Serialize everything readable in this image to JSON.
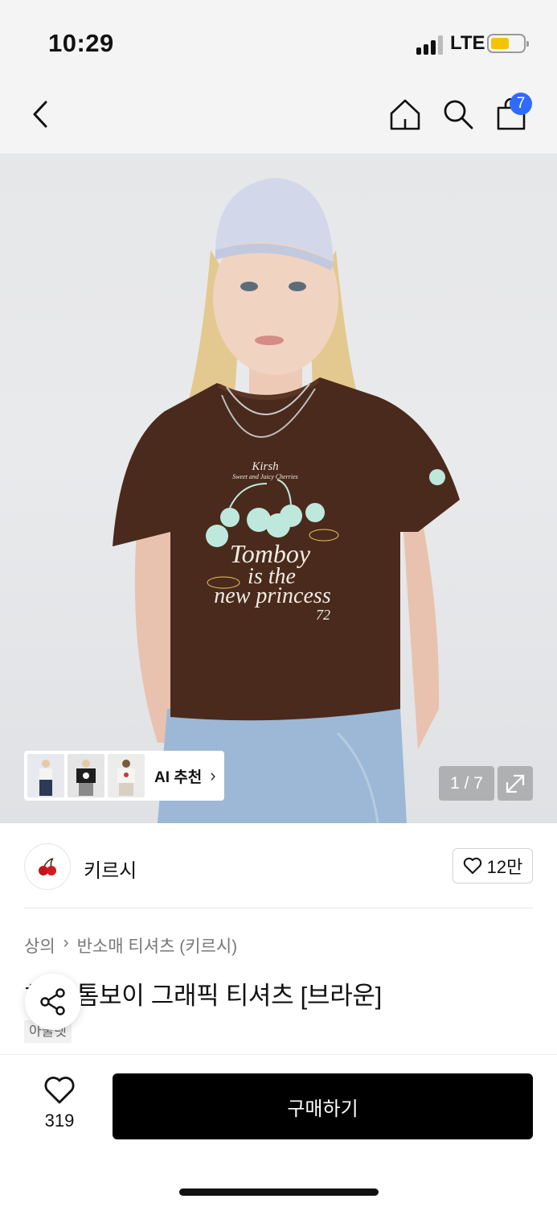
{
  "status": {
    "time": "10:29",
    "network": "LTE"
  },
  "nav": {
    "cart_count": "7"
  },
  "hero": {
    "print_brand": "Kirsh",
    "print_subline": "Sweet and Juicy Cherries",
    "print_line1": "Tomboy",
    "print_line2": "is the",
    "print_line3": "new princess",
    "print_number": "72",
    "image_counter": "1 / 7",
    "ai_label": "AI 추천",
    "ai_chevron": "›"
  },
  "brand": {
    "name": "키르시",
    "likes": "12만"
  },
  "product": {
    "breadcrumb": [
      "상의",
      "›",
      "반소매 티셔츠 (키르시)"
    ],
    "title": "체리 톰보이 그래픽 티셔츠 [브라운]",
    "tag": "아울렛"
  },
  "bottom": {
    "wish_count": "319",
    "buy_label": "구매하기"
  },
  "colors": {
    "accent_blue": "#2f6bff",
    "battery": "#f5c400",
    "tshirt": "#4a2a1c",
    "print_mint": "#bfe8dc"
  }
}
